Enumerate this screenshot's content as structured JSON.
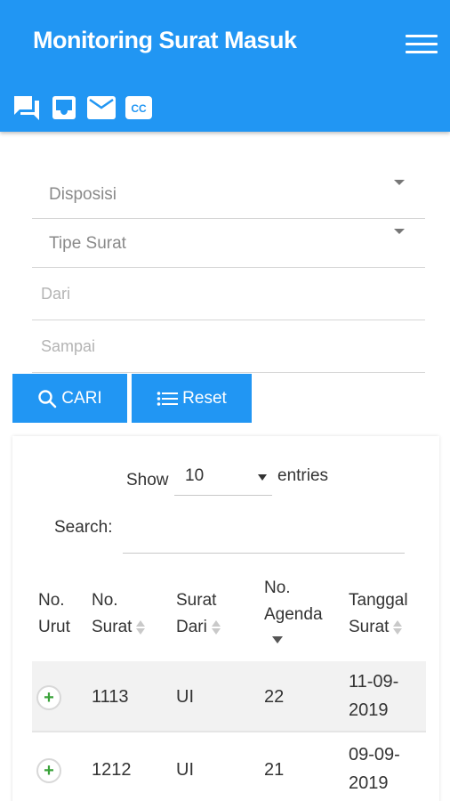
{
  "app": {
    "title": "Monitoring Surat Masuk",
    "accent": "#2196f3"
  },
  "toolbar_icons": [
    "forum-icon",
    "inbox-icon",
    "mail-icon",
    "closed-caption-icon"
  ],
  "filters": {
    "disposisi_placeholder": "Disposisi",
    "tipe_surat_placeholder": "Tipe Surat",
    "dari_placeholder": "Dari",
    "sampai_placeholder": "Sampai"
  },
  "buttons": {
    "cari": "CARI",
    "reset": "Reset"
  },
  "table_controls": {
    "show_label": "Show",
    "page_length": "10",
    "entries_label": "entries",
    "search_label": "Search:"
  },
  "table": {
    "headers": {
      "no_urut_1": "No.",
      "no_urut_2": "Urut",
      "no_surat_1": "No.",
      "no_surat_2": "Surat",
      "surat_dari_1": "Surat",
      "surat_dari_2": "Dari",
      "no_agenda_1": "No.",
      "no_agenda_2": "Agenda",
      "tanggal_surat_1": "Tanggal",
      "tanggal_surat_2": "Surat"
    },
    "rows": [
      {
        "expand": "+",
        "no_surat": "1113",
        "surat_dari": "UI",
        "no_agenda": "22",
        "tanggal_1": "11-09-",
        "tanggal_2": "2019"
      },
      {
        "expand": "+",
        "no_surat": "1212",
        "surat_dari": "UI",
        "no_agenda": "21",
        "tanggal_1": "09-09-",
        "tanggal_2": "2019"
      }
    ]
  }
}
